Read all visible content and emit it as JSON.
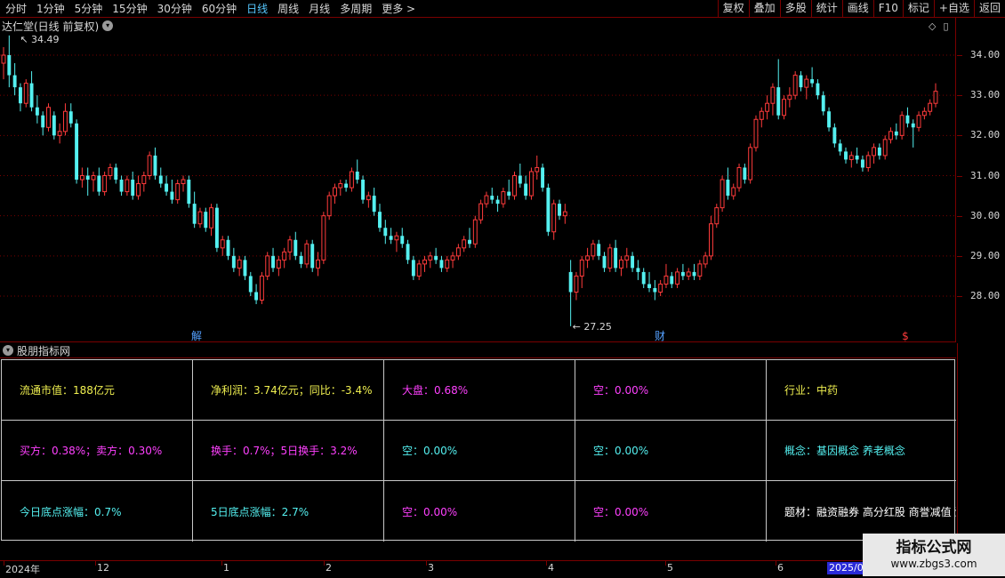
{
  "toolbar": {
    "periods": [
      "分时",
      "1分钟",
      "5分钟",
      "15分钟",
      "30分钟",
      "60分钟",
      "日线",
      "周线",
      "月线",
      "多周期",
      "更多 >"
    ],
    "active_period": "日线",
    "buttons": [
      "复权",
      "叠加",
      "多股",
      "统计",
      "画线",
      "F10",
      "标记",
      "+自选",
      "返回"
    ]
  },
  "chart": {
    "title": "达仁堂(日线 前复权)",
    "high_label": "34.49",
    "low_label": "27.25",
    "y_ticks": [
      "34.00",
      "33.00",
      "32.00",
      "31.00",
      "30.00",
      "29.00",
      "28.00"
    ],
    "markers": [
      "解",
      "财",
      "$"
    ],
    "colors": {
      "up": "#ff3b3b",
      "down": "#54f0f0",
      "grid": "#7a0000",
      "background": "#000000"
    }
  },
  "chart_data": {
    "type": "candlestick",
    "ylim": [
      27.25,
      34.49
    ],
    "y_ticks": [
      28,
      29,
      30,
      31,
      32,
      33,
      34
    ],
    "x_ticks": [
      "2024年",
      "12",
      "1",
      "2",
      "3",
      "4",
      "5",
      "6",
      "2025/0"
    ],
    "ohlc": [
      [
        33.8,
        34.2,
        33.4,
        34.0
      ],
      [
        34.0,
        34.49,
        33.2,
        33.5
      ],
      [
        33.5,
        33.8,
        33.0,
        33.2
      ],
      [
        33.2,
        33.3,
        32.6,
        32.8
      ],
      [
        32.8,
        33.4,
        32.7,
        33.3
      ],
      [
        33.3,
        33.6,
        32.6,
        32.7
      ],
      [
        32.7,
        33.0,
        32.3,
        32.5
      ],
      [
        32.5,
        32.6,
        32.0,
        32.2
      ],
      [
        32.2,
        32.8,
        32.1,
        32.7
      ],
      [
        32.5,
        32.6,
        31.9,
        32.0
      ],
      [
        32.0,
        32.3,
        31.8,
        32.1
      ],
      [
        32.1,
        32.8,
        32.0,
        32.6
      ],
      [
        32.6,
        32.8,
        32.2,
        32.3
      ],
      [
        32.3,
        32.4,
        30.8,
        30.9
      ],
      [
        30.9,
        31.2,
        30.7,
        31.0
      ],
      [
        31.0,
        31.2,
        30.5,
        30.9
      ],
      [
        30.9,
        31.1,
        30.6,
        31.0
      ],
      [
        31.0,
        31.2,
        30.5,
        30.6
      ],
      [
        30.6,
        31.1,
        30.5,
        31.0
      ],
      [
        31.0,
        31.3,
        30.9,
        31.2
      ],
      [
        31.2,
        31.3,
        30.8,
        30.9
      ],
      [
        30.9,
        31.0,
        30.5,
        30.6
      ],
      [
        30.6,
        31.0,
        30.5,
        30.9
      ],
      [
        30.9,
        31.1,
        30.4,
        30.5
      ],
      [
        30.5,
        31.0,
        30.4,
        30.8
      ],
      [
        30.8,
        31.1,
        30.6,
        31.0
      ],
      [
        31.0,
        31.6,
        30.9,
        31.5
      ],
      [
        31.5,
        31.7,
        30.9,
        31.0
      ],
      [
        31.0,
        31.2,
        30.7,
        30.8
      ],
      [
        30.8,
        31.0,
        30.5,
        30.6
      ],
      [
        30.6,
        30.9,
        30.3,
        30.4
      ],
      [
        30.4,
        30.9,
        30.3,
        30.8
      ],
      [
        30.8,
        31.0,
        30.6,
        30.9
      ],
      [
        30.9,
        31.0,
        30.2,
        30.3
      ],
      [
        30.3,
        30.6,
        29.7,
        29.8
      ],
      [
        29.8,
        30.2,
        29.7,
        30.1
      ],
      [
        30.1,
        30.2,
        29.6,
        29.7
      ],
      [
        29.7,
        30.3,
        29.5,
        30.2
      ],
      [
        30.2,
        30.3,
        29.1,
        29.2
      ],
      [
        29.2,
        29.5,
        29.0,
        29.4
      ],
      [
        29.4,
        29.5,
        28.9,
        29.0
      ],
      [
        29.0,
        29.2,
        28.6,
        28.7
      ],
      [
        28.7,
        29.0,
        28.5,
        28.9
      ],
      [
        28.9,
        29.0,
        28.4,
        28.5
      ],
      [
        28.5,
        28.6,
        28.0,
        28.1
      ],
      [
        28.1,
        28.3,
        27.8,
        27.9
      ],
      [
        27.9,
        28.6,
        27.8,
        28.5
      ],
      [
        28.5,
        29.1,
        28.4,
        29.0
      ],
      [
        29.0,
        29.2,
        28.6,
        28.7
      ],
      [
        28.7,
        29.0,
        28.5,
        28.9
      ],
      [
        28.9,
        29.2,
        28.7,
        29.1
      ],
      [
        29.1,
        29.5,
        28.9,
        29.4
      ],
      [
        29.4,
        29.6,
        28.9,
        29.0
      ],
      [
        29.0,
        29.1,
        28.7,
        28.8
      ],
      [
        28.8,
        29.4,
        28.7,
        29.3
      ],
      [
        29.3,
        29.4,
        28.6,
        28.7
      ],
      [
        28.7,
        29.1,
        28.5,
        28.9
      ],
      [
        28.9,
        30.1,
        28.8,
        30.0
      ],
      [
        30.0,
        30.6,
        29.9,
        30.5
      ],
      [
        30.5,
        30.8,
        30.3,
        30.7
      ],
      [
        30.7,
        30.9,
        30.5,
        30.8
      ],
      [
        30.8,
        30.9,
        30.6,
        30.7
      ],
      [
        30.7,
        31.2,
        30.6,
        31.1
      ],
      [
        31.1,
        31.4,
        30.8,
        30.9
      ],
      [
        30.9,
        31.0,
        30.3,
        30.4
      ],
      [
        30.4,
        30.6,
        30.2,
        30.5
      ],
      [
        30.5,
        30.7,
        30.0,
        30.1
      ],
      [
        30.1,
        30.3,
        29.6,
        29.7
      ],
      [
        29.7,
        29.9,
        29.3,
        29.5
      ],
      [
        29.5,
        29.7,
        29.3,
        29.4
      ],
      [
        29.4,
        29.6,
        29.1,
        29.5
      ],
      [
        29.5,
        29.7,
        29.2,
        29.3
      ],
      [
        29.3,
        29.4,
        28.8,
        28.9
      ],
      [
        28.9,
        29.0,
        28.4,
        28.5
      ],
      [
        28.5,
        28.9,
        28.4,
        28.8
      ],
      [
        28.8,
        29.0,
        28.6,
        28.9
      ],
      [
        28.9,
        29.1,
        28.7,
        29.0
      ],
      [
        29.0,
        29.2,
        28.8,
        28.9
      ],
      [
        28.9,
        29.0,
        28.6,
        28.7
      ],
      [
        28.7,
        29.0,
        28.6,
        28.9
      ],
      [
        28.9,
        29.1,
        28.7,
        29.0
      ],
      [
        29.0,
        29.3,
        28.9,
        29.2
      ],
      [
        29.2,
        29.5,
        29.1,
        29.4
      ],
      [
        29.4,
        29.7,
        29.2,
        29.3
      ],
      [
        29.3,
        30.0,
        29.2,
        29.9
      ],
      [
        29.9,
        30.4,
        29.8,
        30.3
      ],
      [
        30.3,
        30.6,
        30.2,
        30.5
      ],
      [
        30.5,
        30.7,
        30.3,
        30.4
      ],
      [
        30.4,
        30.5,
        30.1,
        30.3
      ],
      [
        30.3,
        30.7,
        30.2,
        30.6
      ],
      [
        30.6,
        30.9,
        30.4,
        30.5
      ],
      [
        30.5,
        31.1,
        30.4,
        31.0
      ],
      [
        31.0,
        31.3,
        30.7,
        30.8
      ],
      [
        30.8,
        31.0,
        30.4,
        30.5
      ],
      [
        30.5,
        31.2,
        30.4,
        31.1
      ],
      [
        31.1,
        31.5,
        30.9,
        31.2
      ],
      [
        31.2,
        31.3,
        30.6,
        30.7
      ],
      [
        30.7,
        30.8,
        29.5,
        29.6
      ],
      [
        29.6,
        30.4,
        29.4,
        30.3
      ],
      [
        30.3,
        30.4,
        29.9,
        30.0
      ],
      [
        30.0,
        30.3,
        29.8,
        30.1
      ],
      [
        28.6,
        28.9,
        27.25,
        28.1
      ],
      [
        28.1,
        28.6,
        27.9,
        28.5
      ],
      [
        28.5,
        29.0,
        28.2,
        28.9
      ],
      [
        28.9,
        29.2,
        28.7,
        29.0
      ],
      [
        29.0,
        29.4,
        28.9,
        29.3
      ],
      [
        29.3,
        29.4,
        28.9,
        29.0
      ],
      [
        29.0,
        29.1,
        28.6,
        28.7
      ],
      [
        28.7,
        29.3,
        28.6,
        29.2
      ],
      [
        29.2,
        29.4,
        28.6,
        28.7
      ],
      [
        28.7,
        29.0,
        28.5,
        28.9
      ],
      [
        28.9,
        29.2,
        28.7,
        29.0
      ],
      [
        29.0,
        29.1,
        28.6,
        28.7
      ],
      [
        28.7,
        28.9,
        28.4,
        28.6
      ],
      [
        28.6,
        28.7,
        28.2,
        28.3
      ],
      [
        28.3,
        28.6,
        28.1,
        28.2
      ],
      [
        28.2,
        28.4,
        27.9,
        28.1
      ],
      [
        28.1,
        28.4,
        28.0,
        28.3
      ],
      [
        28.3,
        28.8,
        28.2,
        28.5
      ],
      [
        28.5,
        28.6,
        28.2,
        28.3
      ],
      [
        28.3,
        28.7,
        28.2,
        28.6
      ],
      [
        28.6,
        28.8,
        28.4,
        28.5
      ],
      [
        28.5,
        28.7,
        28.4,
        28.6
      ],
      [
        28.6,
        28.8,
        28.4,
        28.5
      ],
      [
        28.5,
        28.9,
        28.4,
        28.8
      ],
      [
        28.8,
        29.1,
        28.7,
        29.0
      ],
      [
        29.0,
        30.0,
        28.9,
        29.8
      ],
      [
        29.8,
        30.3,
        29.7,
        30.2
      ],
      [
        30.2,
        31.0,
        30.1,
        30.9
      ],
      [
        30.9,
        31.2,
        30.4,
        30.5
      ],
      [
        30.5,
        30.8,
        30.4,
        30.7
      ],
      [
        30.7,
        31.3,
        30.6,
        31.2
      ],
      [
        31.2,
        31.3,
        30.8,
        30.9
      ],
      [
        30.9,
        31.8,
        30.8,
        31.7
      ],
      [
        31.7,
        32.5,
        31.6,
        32.4
      ],
      [
        32.4,
        32.7,
        32.2,
        32.6
      ],
      [
        32.6,
        33.0,
        32.4,
        32.8
      ],
      [
        32.8,
        33.3,
        32.5,
        33.2
      ],
      [
        33.2,
        33.9,
        32.4,
        32.5
      ],
      [
        32.5,
        33.0,
        32.4,
        32.9
      ],
      [
        32.9,
        33.2,
        32.7,
        33.0
      ],
      [
        33.0,
        33.6,
        32.9,
        33.5
      ],
      [
        33.5,
        33.6,
        33.1,
        33.2
      ],
      [
        33.2,
        33.5,
        32.9,
        33.4
      ],
      [
        33.4,
        33.7,
        33.2,
        33.3
      ],
      [
        33.3,
        33.4,
        32.9,
        33.0
      ],
      [
        33.0,
        33.1,
        32.5,
        32.6
      ],
      [
        32.6,
        32.7,
        32.1,
        32.2
      ],
      [
        32.2,
        32.3,
        31.7,
        31.8
      ],
      [
        31.8,
        31.9,
        31.5,
        31.6
      ],
      [
        31.6,
        31.7,
        31.3,
        31.4
      ],
      [
        31.4,
        31.6,
        31.2,
        31.5
      ],
      [
        31.5,
        31.7,
        31.3,
        31.4
      ],
      [
        31.4,
        31.5,
        31.1,
        31.2
      ],
      [
        31.2,
        31.6,
        31.1,
        31.5
      ],
      [
        31.5,
        31.8,
        31.3,
        31.7
      ],
      [
        31.7,
        31.8,
        31.4,
        31.5
      ],
      [
        31.5,
        32.0,
        31.4,
        31.9
      ],
      [
        31.9,
        32.2,
        31.8,
        32.1
      ],
      [
        32.1,
        32.3,
        31.9,
        32.0
      ],
      [
        32.0,
        32.6,
        31.9,
        32.5
      ],
      [
        32.5,
        32.7,
        32.2,
        32.3
      ],
      [
        32.3,
        32.4,
        31.7,
        32.2
      ],
      [
        32.2,
        32.6,
        32.1,
        32.5
      ],
      [
        32.5,
        32.7,
        32.4,
        32.6
      ],
      [
        32.6,
        32.9,
        32.5,
        32.8
      ],
      [
        32.8,
        33.3,
        32.7,
        33.1
      ]
    ]
  },
  "panel": {
    "title": "股朋指标网",
    "cells": [
      {
        "text": "流通市值：188亿元",
        "color": "#f0f050"
      },
      {
        "text": "净利润：3.74亿元；同比：-3.4%",
        "color": "#f0f050"
      },
      {
        "text": "大盘：0.68%",
        "color": "#ff40ff"
      },
      {
        "text": "空：0.00%",
        "color": "#ff40ff"
      },
      {
        "text": "行业：中药",
        "color": "#f0f050"
      },
      {
        "text": "买方：0.38%；卖方：0.30%",
        "color": "#ff40ff"
      },
      {
        "text": "换手：0.7%；5日换手：3.2%",
        "color": "#ff40ff"
      },
      {
        "text": "空：0.00%",
        "color": "#54f0f0"
      },
      {
        "text": "空：0.00%",
        "color": "#54f0f0"
      },
      {
        "text": "概念：基因概念 养老概念",
        "color": "#54f0f0"
      },
      {
        "text": "今日底点涨幅：0.7%",
        "color": "#54f0f0"
      },
      {
        "text": "5日底点涨幅：2.7%",
        "color": "#54f0f0"
      },
      {
        "text": "空：0.00%",
        "color": "#ff40ff"
      },
      {
        "text": "空：0.00%",
        "color": "#ff40ff"
      },
      {
        "text": "题材：融资融券 高分红股 商誉减值 沪",
        "color": "#ffffff"
      }
    ]
  },
  "date_axis": {
    "labels": [
      "2024年",
      "12",
      "1",
      "2",
      "3",
      "4",
      "5",
      "6"
    ],
    "selected": "2025/0"
  },
  "watermark": {
    "line1": "指标公式网",
    "line2": "www.zbgs3.com"
  }
}
